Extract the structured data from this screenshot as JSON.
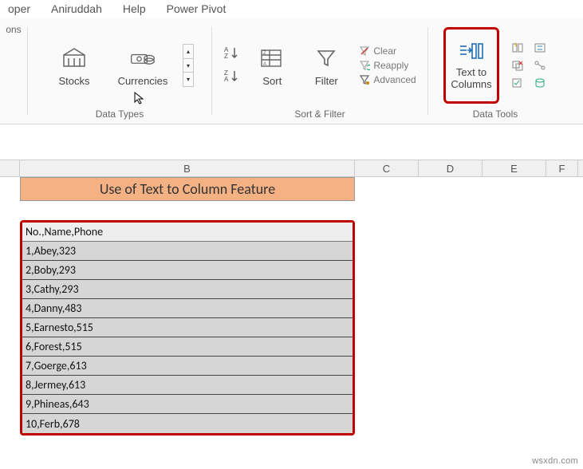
{
  "menubar": {
    "items": [
      "oper",
      "Aniruddah",
      "Help",
      "Power Pivot"
    ]
  },
  "ribbon": {
    "addins_label": "ons",
    "data_types": {
      "stocks": "Stocks",
      "currencies": "Currencies",
      "group_label": "Data Types"
    },
    "sort_filter": {
      "sort": "Sort",
      "filter": "Filter",
      "clear": "Clear",
      "reapply": "Reapply",
      "advanced": "Advanced",
      "group_label": "Sort & Filter"
    },
    "data_tools": {
      "text_to_columns_line1": "Text to",
      "text_to_columns_line2": "Columns",
      "group_label": "Data Tools"
    }
  },
  "columns": {
    "B": "B",
    "C": "C",
    "D": "D",
    "E": "E",
    "F": "F"
  },
  "title_cell": "Use of Text to Column Feature",
  "data_rows": [
    "No.,Name,Phone",
    "1,Abey,323",
    "2,Boby,293",
    "3,Cathy,293",
    "4,Danny,483",
    "5,Earnesto,515",
    "6,Forest,515",
    "7,Goerge,613",
    "8,Jermey,613",
    "9,Phineas,643",
    "10,Ferb,678"
  ],
  "watermark": "wsxdn.com",
  "chart_data": {
    "type": "table",
    "title": "Use of Text to Column Feature",
    "raw_csv_header": "No.,Name,Phone",
    "rows": [
      {
        "No.": 1,
        "Name": "Abey",
        "Phone": 323
      },
      {
        "No.": 2,
        "Name": "Boby",
        "Phone": 293
      },
      {
        "No.": 3,
        "Name": "Cathy",
        "Phone": 293
      },
      {
        "No.": 4,
        "Name": "Danny",
        "Phone": 483
      },
      {
        "No.": 5,
        "Name": "Earnesto",
        "Phone": 515
      },
      {
        "No.": 6,
        "Name": "Forest",
        "Phone": 515
      },
      {
        "No.": 7,
        "Name": "Goerge",
        "Phone": 613
      },
      {
        "No.": 8,
        "Name": "Jermey",
        "Phone": 613
      },
      {
        "No.": 9,
        "Name": "Phineas",
        "Phone": 643
      },
      {
        "No.": 10,
        "Name": "Ferb",
        "Phone": 678
      }
    ]
  }
}
